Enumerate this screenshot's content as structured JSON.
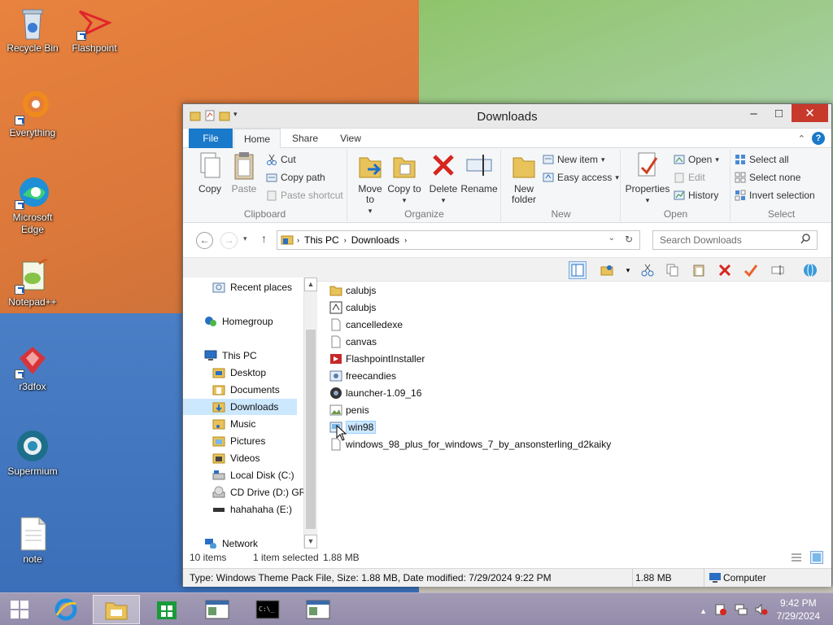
{
  "desktop": {
    "icons": [
      {
        "label": "Recycle Bin"
      },
      {
        "label": "Flashpoint"
      },
      {
        "label": "Everything"
      },
      {
        "label": "Microsoft Edge"
      },
      {
        "label": "Notepad++"
      },
      {
        "label": "r3dfox"
      },
      {
        "label": "Supermium"
      },
      {
        "label": "note"
      }
    ]
  },
  "window": {
    "title": "Downloads",
    "controls": {
      "minimize": "–",
      "maximize": "□",
      "close": "✕"
    },
    "tabs": {
      "file": "File",
      "home": "Home",
      "share": "Share",
      "view": "View"
    },
    "ribbon": {
      "clipboard": {
        "label": "Clipboard",
        "copy": "Copy",
        "paste": "Paste",
        "cut": "Cut",
        "copy_path": "Copy path",
        "paste_shortcut": "Paste shortcut"
      },
      "organize": {
        "label": "Organize",
        "move_to": "Move to",
        "copy_to": "Copy to",
        "delete": "Delete",
        "rename": "Rename"
      },
      "new": {
        "label": "New",
        "new_folder": "New folder",
        "new_item": "New item",
        "easy_access": "Easy access"
      },
      "open": {
        "label": "Open",
        "properties": "Properties",
        "open": "Open",
        "edit": "Edit",
        "history": "History"
      },
      "select": {
        "label": "Select",
        "select_all": "Select all",
        "select_none": "Select none",
        "invert_selection": "Invert selection"
      }
    },
    "address": {
      "root": "This PC",
      "folder": "Downloads",
      "sep": "›"
    },
    "search": {
      "placeholder": "Search Downloads"
    },
    "nav": [
      {
        "label": "Recent places"
      },
      {
        "label": "Homegroup"
      },
      {
        "label": "This PC"
      },
      {
        "label": "Desktop"
      },
      {
        "label": "Documents"
      },
      {
        "label": "Downloads"
      },
      {
        "label": "Music"
      },
      {
        "label": "Pictures"
      },
      {
        "label": "Videos"
      },
      {
        "label": "Local Disk (C:)"
      },
      {
        "label": "CD Drive (D:) GRM"
      },
      {
        "label": "hahahaha (E:)"
      },
      {
        "label": "Network"
      }
    ],
    "files": [
      {
        "name": "calubjs"
      },
      {
        "name": "calubjs"
      },
      {
        "name": "cancelledexe"
      },
      {
        "name": "canvas"
      },
      {
        "name": "FlashpointInstaller"
      },
      {
        "name": "freecandies"
      },
      {
        "name": "launcher-1.09_16"
      },
      {
        "name": "penis"
      },
      {
        "name": "win98"
      },
      {
        "name": "windows_98_plus_for_windows_7_by_ansonsterling_d2kaiky"
      }
    ],
    "status": {
      "count": "10 items",
      "selected": "1 item selected",
      "size": "1.88 MB"
    },
    "details": {
      "type": "Type: Windows Theme Pack File, Size: 1.88 MB, Date modified: 7/29/2024 9:22 PM",
      "size": "1.88 MB",
      "location": "Computer"
    }
  },
  "taskbar": {
    "time": "9:42 PM",
    "date": "7/29/2024"
  },
  "colors": {
    "accent": "#1979ca",
    "selection": "#cce8ff",
    "close": "#c7392b"
  }
}
